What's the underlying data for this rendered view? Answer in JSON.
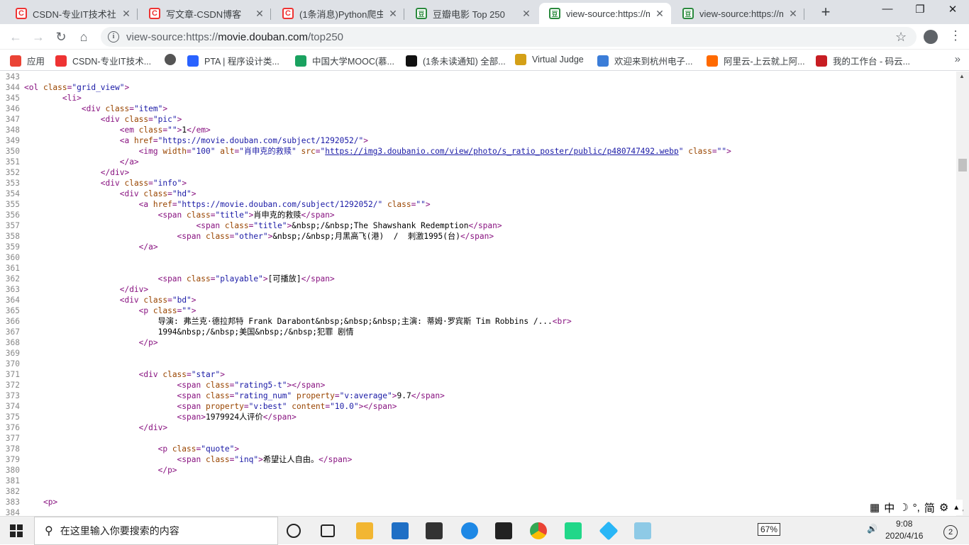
{
  "tabs": [
    {
      "title": "CSDN-专业IT技术社区",
      "favicon": "csdn-icon"
    },
    {
      "title": "写文章-CSDN博客",
      "favicon": "csdn-icon"
    },
    {
      "title": "(1条消息)Python爬虫实",
      "favicon": "csdn-icon"
    },
    {
      "title": "豆瓣电影 Top 250",
      "favicon": "douban-icon"
    },
    {
      "title": "view-source:https://m",
      "favicon": "douban-icon"
    },
    {
      "title": "view-source:https://m",
      "favicon": "douban-icon"
    }
  ],
  "address": {
    "prefix": "view-source:https://",
    "domain": "movie.douban.com",
    "path": "/top250"
  },
  "bookmarks": [
    {
      "label": "应用",
      "icon": "apps-icon"
    },
    {
      "label": "CSDN-专业IT技术...",
      "icon": "csdn-icon"
    },
    {
      "label": "",
      "icon": "globe-icon"
    },
    {
      "label": "PTA | 程序设计类...",
      "icon": "pta-icon"
    },
    {
      "label": "中国大学MOOC(慕...",
      "icon": "mooc-icon"
    },
    {
      "label": "(1条未读通知) 全部...",
      "icon": "zhihu-icon"
    },
    {
      "label": "Virtual Judge",
      "icon": "vjudge-icon"
    },
    {
      "label": "欢迎来到杭州电子...",
      "icon": "hdu-icon"
    },
    {
      "label": "阿里云-上云就上阿...",
      "icon": "aliyun-icon"
    },
    {
      "label": "我的工作台 - 码云...",
      "icon": "gitee-icon"
    }
  ],
  "source_lines": [
    {
      "n": "343",
      "html": ""
    },
    {
      "n": "344",
      "html": "<span class=\"t\">&lt;ol </span><span class=\"a\">class</span><span class=\"t\">=</span><span class=\"v\">\"grid_view\"</span><span class=\"t\">&gt;</span>"
    },
    {
      "n": "345",
      "html": "        <span class=\"t\">&lt;li&gt;</span>"
    },
    {
      "n": "346",
      "html": "            <span class=\"t\">&lt;div </span><span class=\"a\">class</span><span class=\"t\">=</span><span class=\"v\">\"item\"</span><span class=\"t\">&gt;</span>"
    },
    {
      "n": "347",
      "html": "                <span class=\"t\">&lt;div </span><span class=\"a\">class</span><span class=\"t\">=</span><span class=\"v\">\"pic\"</span><span class=\"t\">&gt;</span>"
    },
    {
      "n": "348",
      "html": "                    <span class=\"t\">&lt;em </span><span class=\"a\">class</span><span class=\"t\">=</span><span class=\"v\">\"\"</span><span class=\"t\">&gt;</span>1<span class=\"t\">&lt;/em&gt;</span>"
    },
    {
      "n": "349",
      "html": "                    <span class=\"t\">&lt;a </span><span class=\"a\">href</span><span class=\"t\">=</span><span class=\"v\">\"https://movie.douban.com/subject/1292052/\"</span><span class=\"t\">&gt;</span>"
    },
    {
      "n": "350",
      "html": "                        <span class=\"t\">&lt;img </span><span class=\"a\">width</span><span class=\"t\">=</span><span class=\"v\">\"100\"</span> <span class=\"a\">alt</span><span class=\"t\">=</span><span class=\"v\">\"肖申克的救赎\"</span> <span class=\"a\">src</span><span class=\"t\">=</span><span class=\"v\">\"</span><span class=\"u\">https://img3.doubanio.com/view/photo/s_ratio_poster/public/p480747492.webp</span><span class=\"v\">\"</span> <span class=\"a\">class</span><span class=\"t\">=</span><span class=\"v\">\"\"</span><span class=\"t\">&gt;</span>"
    },
    {
      "n": "351",
      "html": "                    <span class=\"t\">&lt;/a&gt;</span>"
    },
    {
      "n": "352",
      "html": "                <span class=\"t\">&lt;/div&gt;</span>"
    },
    {
      "n": "353",
      "html": "                <span class=\"t\">&lt;div </span><span class=\"a\">class</span><span class=\"t\">=</span><span class=\"v\">\"info\"</span><span class=\"t\">&gt;</span>"
    },
    {
      "n": "354",
      "html": "                    <span class=\"t\">&lt;div </span><span class=\"a\">class</span><span class=\"t\">=</span><span class=\"v\">\"hd\"</span><span class=\"t\">&gt;</span>"
    },
    {
      "n": "355",
      "html": "                        <span class=\"t\">&lt;a </span><span class=\"a\">href</span><span class=\"t\">=</span><span class=\"v\">\"https://movie.douban.com/subject/1292052/\"</span> <span class=\"a\">class</span><span class=\"t\">=</span><span class=\"v\">\"\"</span><span class=\"t\">&gt;</span>"
    },
    {
      "n": "356",
      "html": "                            <span class=\"t\">&lt;span </span><span class=\"a\">class</span><span class=\"t\">=</span><span class=\"v\">\"title\"</span><span class=\"t\">&gt;</span>肖申克的救赎<span class=\"t\">&lt;/span&gt;</span>"
    },
    {
      "n": "357",
      "html": "                                    <span class=\"t\">&lt;span </span><span class=\"a\">class</span><span class=\"t\">=</span><span class=\"v\">\"title\"</span><span class=\"t\">&gt;</span>&amp;nbsp;/&amp;nbsp;The Shawshank Redemption<span class=\"t\">&lt;/span&gt;</span>"
    },
    {
      "n": "358",
      "html": "                                <span class=\"t\">&lt;span </span><span class=\"a\">class</span><span class=\"t\">=</span><span class=\"v\">\"other\"</span><span class=\"t\">&gt;</span>&amp;nbsp;/&amp;nbsp;月黑高飞(港)  /  刺激1995(台)<span class=\"t\">&lt;/span&gt;</span>"
    },
    {
      "n": "359",
      "html": "                        <span class=\"t\">&lt;/a&gt;</span>"
    },
    {
      "n": "360",
      "html": ""
    },
    {
      "n": "361",
      "html": ""
    },
    {
      "n": "362",
      "html": "                            <span class=\"t\">&lt;span </span><span class=\"a\">class</span><span class=\"t\">=</span><span class=\"v\">\"playable\"</span><span class=\"t\">&gt;</span>[可播放]<span class=\"t\">&lt;/span&gt;</span>"
    },
    {
      "n": "363",
      "html": "                    <span class=\"t\">&lt;/div&gt;</span>"
    },
    {
      "n": "364",
      "html": "                    <span class=\"t\">&lt;div </span><span class=\"a\">class</span><span class=\"t\">=</span><span class=\"v\">\"bd\"</span><span class=\"t\">&gt;</span>"
    },
    {
      "n": "365",
      "html": "                        <span class=\"t\">&lt;p </span><span class=\"a\">class</span><span class=\"t\">=</span><span class=\"v\">\"\"</span><span class=\"t\">&gt;</span>"
    },
    {
      "n": "366",
      "html": "                            导演: 弗兰克·德拉邦特 Frank Darabont&amp;nbsp;&amp;nbsp;&amp;nbsp;主演: 蒂姆·罗宾斯 Tim Robbins /...<span class=\"t\">&lt;br&gt;</span>"
    },
    {
      "n": "367",
      "html": "                            1994&amp;nbsp;/&amp;nbsp;美国&amp;nbsp;/&amp;nbsp;犯罪 剧情"
    },
    {
      "n": "368",
      "html": "                        <span class=\"t\">&lt;/p&gt;</span>"
    },
    {
      "n": "369",
      "html": ""
    },
    {
      "n": "370",
      "html": ""
    },
    {
      "n": "371",
      "html": "                        <span class=\"t\">&lt;div </span><span class=\"a\">class</span><span class=\"t\">=</span><span class=\"v\">\"star\"</span><span class=\"t\">&gt;</span>"
    },
    {
      "n": "372",
      "html": "                                <span class=\"t\">&lt;span </span><span class=\"a\">class</span><span class=\"t\">=</span><span class=\"v\">\"rating5-t\"</span><span class=\"t\">&gt;&lt;/span&gt;</span>"
    },
    {
      "n": "373",
      "html": "                                <span class=\"t\">&lt;span </span><span class=\"a\">class</span><span class=\"t\">=</span><span class=\"v\">\"rating_num\"</span> <span class=\"a\">property</span><span class=\"t\">=</span><span class=\"v\">\"v:average\"</span><span class=\"t\">&gt;</span>9.7<span class=\"t\">&lt;/span&gt;</span>"
    },
    {
      "n": "374",
      "html": "                                <span class=\"t\">&lt;span </span><span class=\"a\">property</span><span class=\"t\">=</span><span class=\"v\">\"v:best\"</span> <span class=\"a\">content</span><span class=\"t\">=</span><span class=\"v\">\"10.0\"</span><span class=\"t\">&gt;&lt;/span&gt;</span>"
    },
    {
      "n": "375",
      "html": "                                <span class=\"t\">&lt;span&gt;</span>1979924人评价<span class=\"t\">&lt;/span&gt;</span>"
    },
    {
      "n": "376",
      "html": "                        <span class=\"t\">&lt;/div&gt;</span>"
    },
    {
      "n": "377",
      "html": ""
    },
    {
      "n": "378",
      "html": "                            <span class=\"t\">&lt;p </span><span class=\"a\">class</span><span class=\"t\">=</span><span class=\"v\">\"quote\"</span><span class=\"t\">&gt;</span>"
    },
    {
      "n": "379",
      "html": "                                <span class=\"t\">&lt;span </span><span class=\"a\">class</span><span class=\"t\">=</span><span class=\"v\">\"inq\"</span><span class=\"t\">&gt;</span>希望让人自由。<span class=\"t\">&lt;/span&gt;</span>"
    },
    {
      "n": "380",
      "html": "                            <span class=\"t\">&lt;/p&gt;</span>"
    },
    {
      "n": "381",
      "html": ""
    },
    {
      "n": "382",
      "html": ""
    },
    {
      "n": "383",
      "html": "    <span class=\"t\">&lt;p&gt;</span>"
    },
    {
      "n": "384",
      "html": ""
    }
  ],
  "ime": {
    "mode": "中",
    "punct": "简"
  },
  "taskbar": {
    "search_placeholder": "在这里输入你要搜索的内容",
    "battery": "67%",
    "time": "9:08",
    "date": "2020/4/16",
    "notif_count": "2"
  }
}
